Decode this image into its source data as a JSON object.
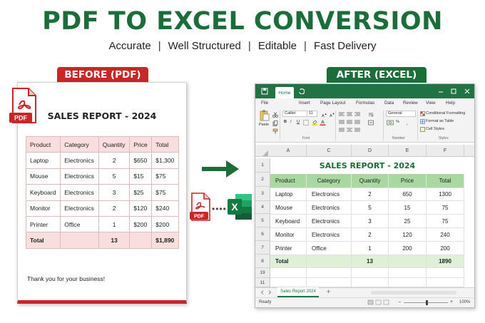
{
  "header": {
    "title": "PDF TO EXCEL CONVERSION",
    "features": [
      "Accurate",
      "Well Structured",
      "Editable",
      "Fast Delivery"
    ],
    "separator": "|"
  },
  "pdf": {
    "tag": "BEFORE (PDF)",
    "icon_label": "PDF",
    "report_title": "SALES REPORT - 2024",
    "columns": [
      "Product",
      "Category",
      "Quantity",
      "Price",
      "Total"
    ],
    "rows": [
      [
        "Laptop",
        "Electronics",
        "2",
        "$650",
        "$1,300"
      ],
      [
        "Mouse",
        "Electronics",
        "5",
        "$15",
        "$75"
      ],
      [
        "Keyboard",
        "Electronics",
        "3",
        "$25",
        "$75"
      ],
      [
        "Monitor",
        "Electronics",
        "2",
        "$120",
        "$240"
      ],
      [
        "Printer",
        "Office",
        "1",
        "$200",
        "$200"
      ]
    ],
    "total_row": [
      "Total",
      "",
      "13",
      "",
      "$1,890"
    ],
    "footer": "Thank you for your business!"
  },
  "middle": {
    "pdf_label": "PDF",
    "dots": "••••",
    "excel_letter": "X"
  },
  "excel": {
    "tag": "AFTER (EXCEL)",
    "title_tab": "Home",
    "menu": [
      "File",
      "Insert",
      "Page Layout",
      "Formulas",
      "Data",
      "Review",
      "View",
      "Help"
    ],
    "ribbon": {
      "paste": "Paste",
      "font_name": "Calibri",
      "font_size": "11",
      "number_format": "General",
      "bold": "B",
      "italic": "I",
      "underline": "U",
      "percent": "%",
      "cond_format": "Conditional Formatting",
      "format_table": "Format as Table",
      "cell_styles": "Cell Styles",
      "font_group": "Font",
      "number_group": "Number",
      "styles_group": "Styles"
    },
    "col_headers": [
      "A",
      "C",
      "D",
      "E",
      "F"
    ],
    "row_headers": [
      "1",
      "2",
      "3",
      "4",
      "5",
      "6",
      "7",
      "8",
      "19",
      "11"
    ],
    "sheet_title": "SALES REPORT - 2024",
    "columns": [
      "Product",
      "Category",
      "Quantity",
      "Price",
      "Total"
    ],
    "rows": [
      [
        "Laptop",
        "Electronics",
        "2",
        "650",
        "1300"
      ],
      [
        "Mouse",
        "Electronics",
        "5",
        "15",
        "75"
      ],
      [
        "Keyboard",
        "Electronics",
        "3",
        "25",
        "75"
      ],
      [
        "Monitor",
        "Electronics",
        "2",
        "120",
        "240"
      ],
      [
        "Printer",
        "Office",
        "1",
        "200",
        "200"
      ]
    ],
    "total_row": [
      "Total",
      "",
      "13",
      "",
      "1890"
    ],
    "sheet_tab": "Sales Report 2024",
    "add_sheet": "+",
    "status": "Ready",
    "zoom": "100%"
  }
}
